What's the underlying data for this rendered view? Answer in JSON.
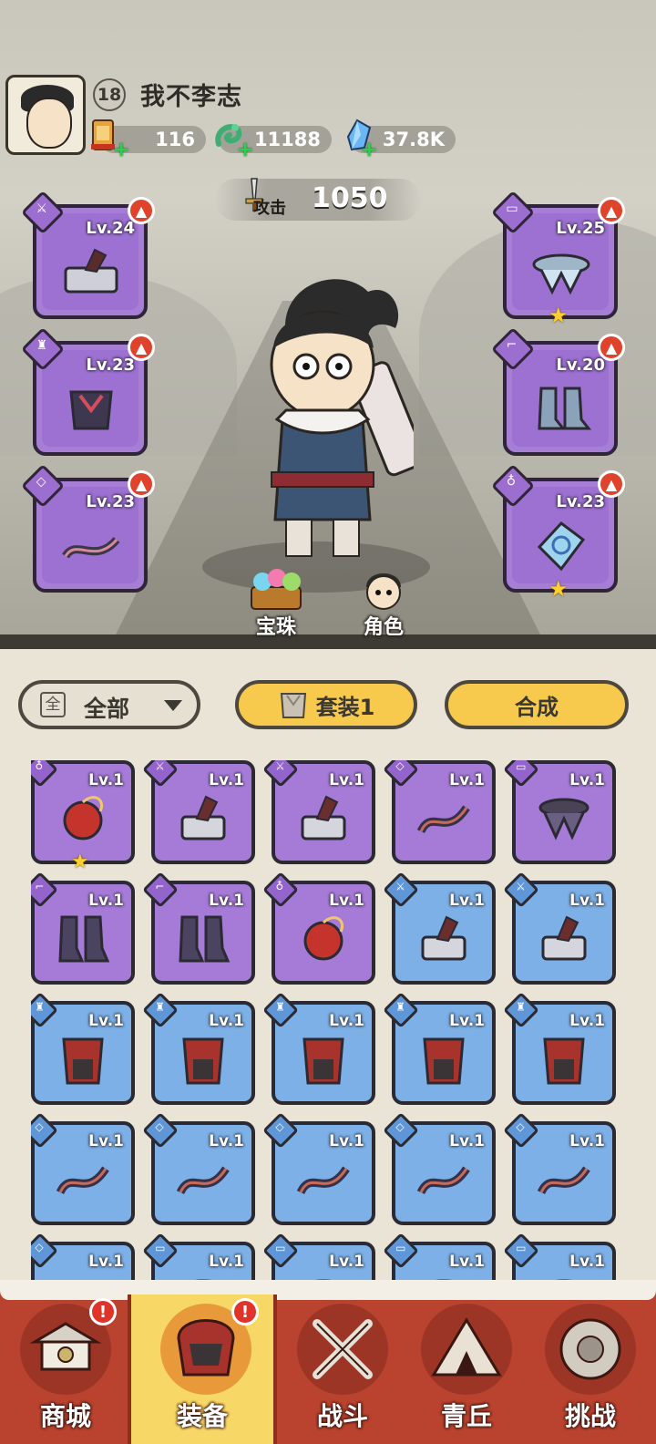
{
  "player": {
    "level": "18",
    "name": "我不李志"
  },
  "resources": [
    {
      "name": "scroll-icon",
      "value": "116"
    },
    {
      "name": "jade-dragon-icon",
      "value": "11188"
    },
    {
      "name": "crystal-icon",
      "value": "37.8K"
    }
  ],
  "attack": {
    "label": "攻击",
    "value": "1050"
  },
  "equipped": {
    "left": [
      {
        "slot": "weapon",
        "level": "Lv.24",
        "upgrade": true,
        "star": false
      },
      {
        "slot": "armor",
        "level": "Lv.23",
        "upgrade": true,
        "star": false
      },
      {
        "slot": "bracers",
        "level": "Lv.23",
        "upgrade": true,
        "star": false
      }
    ],
    "right": [
      {
        "slot": "belt",
        "level": "Lv.25",
        "upgrade": true,
        "star": true
      },
      {
        "slot": "boots",
        "level": "Lv.20",
        "upgrade": true,
        "star": false
      },
      {
        "slot": "pendant",
        "level": "Lv.23",
        "upgrade": true,
        "star": true
      }
    ]
  },
  "scene_buttons": {
    "orbs": "宝珠",
    "character": "角色"
  },
  "filter": {
    "icon_char": "全",
    "label": "全部"
  },
  "set_button": "套装1",
  "compose_button": "合成",
  "inventory": [
    {
      "rarity": "purple",
      "slot": "pendant",
      "level": "Lv.1",
      "star": true
    },
    {
      "rarity": "purple",
      "slot": "weapon",
      "level": "Lv.1",
      "star": false
    },
    {
      "rarity": "purple",
      "slot": "weapon",
      "level": "Lv.1",
      "star": false
    },
    {
      "rarity": "purple",
      "slot": "bracers",
      "level": "Lv.1",
      "star": false
    },
    {
      "rarity": "purple",
      "slot": "belt",
      "level": "Lv.1",
      "star": false
    },
    {
      "rarity": "purple",
      "slot": "boots",
      "level": "Lv.1",
      "star": false
    },
    {
      "rarity": "purple",
      "slot": "boots",
      "level": "Lv.1",
      "star": false
    },
    {
      "rarity": "purple",
      "slot": "pendant",
      "level": "Lv.1",
      "star": false
    },
    {
      "rarity": "blue",
      "slot": "weapon",
      "level": "Lv.1",
      "star": false
    },
    {
      "rarity": "blue",
      "slot": "weapon",
      "level": "Lv.1",
      "star": false
    },
    {
      "rarity": "blue",
      "slot": "armor",
      "level": "Lv.1",
      "star": false
    },
    {
      "rarity": "blue",
      "slot": "armor",
      "level": "Lv.1",
      "star": false
    },
    {
      "rarity": "blue",
      "slot": "armor",
      "level": "Lv.1",
      "star": false
    },
    {
      "rarity": "blue",
      "slot": "armor",
      "level": "Lv.1",
      "star": false
    },
    {
      "rarity": "blue",
      "slot": "armor",
      "level": "Lv.1",
      "star": false
    },
    {
      "rarity": "blue",
      "slot": "bracers",
      "level": "Lv.1",
      "star": false
    },
    {
      "rarity": "blue",
      "slot": "bracers",
      "level": "Lv.1",
      "star": false
    },
    {
      "rarity": "blue",
      "slot": "bracers",
      "level": "Lv.1",
      "star": false
    },
    {
      "rarity": "blue",
      "slot": "bracers",
      "level": "Lv.1",
      "star": false
    },
    {
      "rarity": "blue",
      "slot": "bracers",
      "level": "Lv.1",
      "star": false
    },
    {
      "rarity": "blue",
      "slot": "bracers",
      "level": "Lv.1",
      "star": false
    },
    {
      "rarity": "blue",
      "slot": "belt",
      "level": "Lv.1",
      "star": false
    },
    {
      "rarity": "blue",
      "slot": "belt",
      "level": "Lv.1",
      "star": false
    },
    {
      "rarity": "blue",
      "slot": "belt",
      "level": "Lv.1",
      "star": false
    },
    {
      "rarity": "blue",
      "slot": "belt",
      "level": "Lv.1",
      "star": false
    }
  ],
  "nav": [
    {
      "id": "shop",
      "label": "商城",
      "alert": true,
      "active": false
    },
    {
      "id": "equip",
      "label": "装备",
      "alert": true,
      "active": true
    },
    {
      "id": "battle",
      "label": "战斗",
      "alert": false,
      "active": false
    },
    {
      "id": "qingqiu",
      "label": "青丘",
      "alert": false,
      "active": false
    },
    {
      "id": "challenge",
      "label": "挑战",
      "alert": false,
      "active": false
    }
  ],
  "colors": {
    "purple_rarity": "#a67bd8",
    "blue_rarity": "#7cb0e6",
    "button_yellow": "#f7c94d",
    "nav_red": "#b9432f",
    "nav_active": "#f7d866",
    "alert_red": "#e0332a",
    "star_gold": "#ffcf2b"
  }
}
